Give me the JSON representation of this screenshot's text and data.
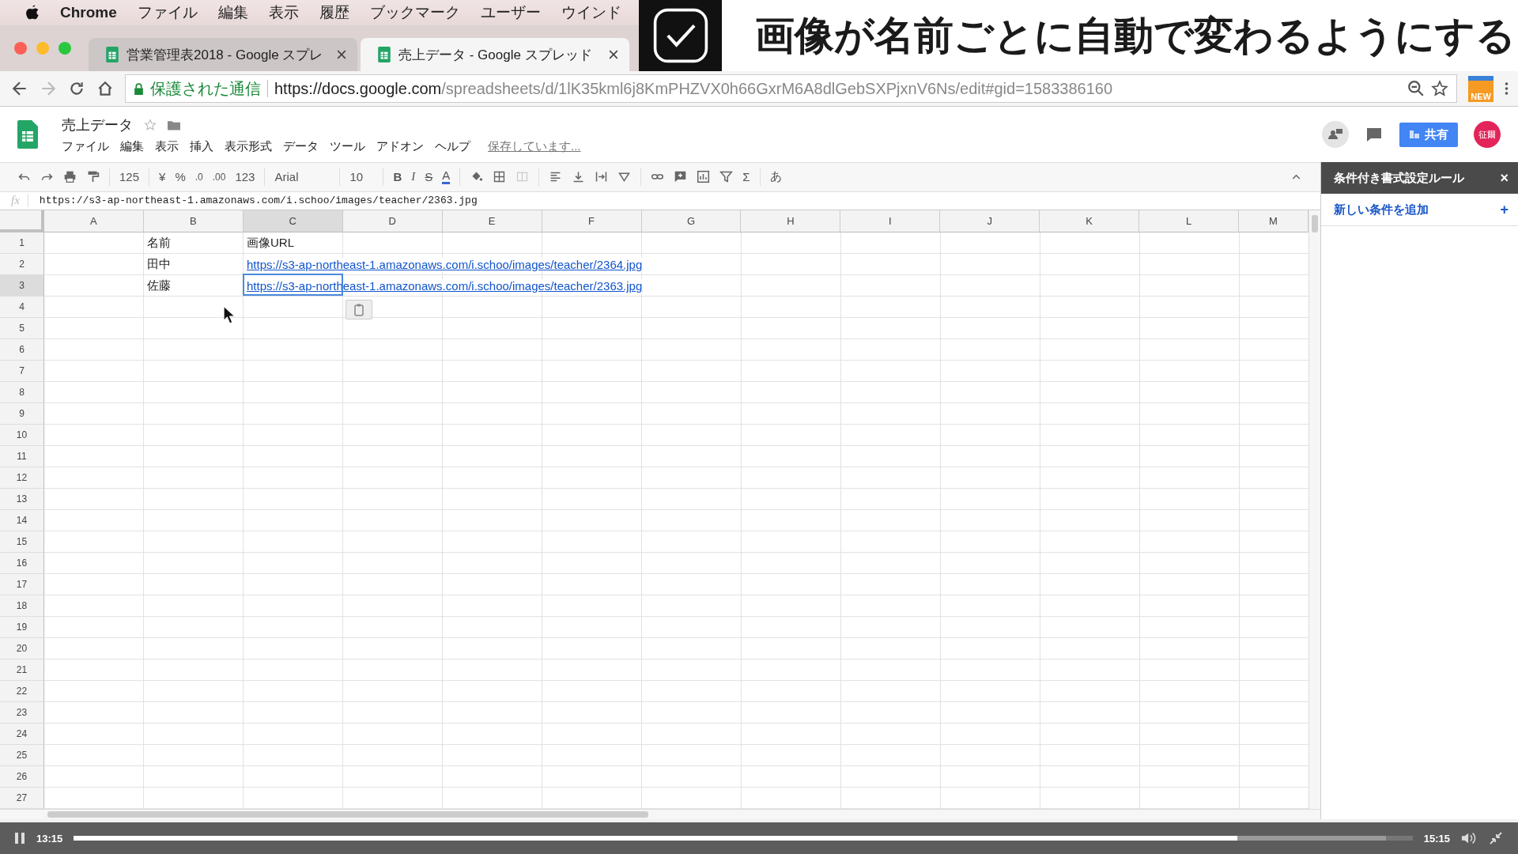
{
  "menu_bar": {
    "app": "Chrome",
    "items": [
      "ファイル",
      "編集",
      "表示",
      "履歴",
      "ブックマーク",
      "ユーザー",
      "ウインド"
    ]
  },
  "browser_tabs": [
    {
      "title": "営業管理表2018 - Google スプレ",
      "selected": false
    },
    {
      "title": "売上データ - Google スプレッド",
      "selected": true
    }
  ],
  "overlay_title": "画像が名前ごとに自動で変わるようにする",
  "address_bar": {
    "security": "保護された通信",
    "url_host": "https://docs.google.com",
    "url_path": "/spreadsheets/d/1lK35kml6j8KmPHZVX0h66GxrM6A8dlGebSXPjxnV6Ns/edit#gid=1583386160",
    "badge": "NEW"
  },
  "doc": {
    "title": "売上データ",
    "menus": [
      "ファイル",
      "編集",
      "表示",
      "挿入",
      "表示形式",
      "データ",
      "ツール",
      "アドオン",
      "ヘルプ"
    ],
    "save_status": "保存しています...",
    "share": "共有",
    "avatar": "征爾"
  },
  "toolbar": {
    "zoom": "125",
    "currency": "¥",
    "percent": "%",
    "decrease_decimal": ".0",
    "increase_decimal": ".00",
    "number_format": "123",
    "font": "Arial",
    "font_size": "10",
    "bold": "B",
    "italic": "I",
    "strike": "S",
    "text_color": "A",
    "sum": "Σ",
    "input_tools": "あ"
  },
  "formula_bar": {
    "label": "fx",
    "value": "https://s3-ap-northeast-1.amazonaws.com/i.schoo/images/teacher/2363.jpg"
  },
  "columns": [
    {
      "label": "A",
      "selected": false
    },
    {
      "label": "B",
      "selected": false
    },
    {
      "label": "C",
      "selected": true
    },
    {
      "label": "D",
      "selected": false
    },
    {
      "label": "E",
      "selected": false
    },
    {
      "label": "F",
      "selected": false
    },
    {
      "label": "G",
      "selected": false
    },
    {
      "label": "H",
      "selected": false
    },
    {
      "label": "I",
      "selected": false
    },
    {
      "label": "J",
      "selected": false
    },
    {
      "label": "K",
      "selected": false
    },
    {
      "label": "L",
      "selected": false
    },
    {
      "label": "M",
      "selected": false
    }
  ],
  "rows": [
    {
      "label": "1",
      "selected": false,
      "cells": [
        null,
        {
          "text": "名前",
          "kind": "text"
        },
        {
          "text": "画像URL",
          "kind": "text"
        }
      ]
    },
    {
      "label": "2",
      "selected": false,
      "cells": [
        null,
        {
          "text": "田中",
          "kind": "text"
        },
        {
          "text": "https://s3-ap-northeast-1.amazonaws.com/i.schoo/images/teacher/2364.jpg",
          "kind": "link",
          "selected": false
        }
      ]
    },
    {
      "label": "3",
      "selected": true,
      "cells": [
        null,
        {
          "text": "佐藤",
          "kind": "text"
        },
        {
          "text": "https://s3-ap-northeast-1.amazonaws.com/i.schoo/images/teacher/2363.jpg",
          "kind": "link",
          "selected": true
        }
      ]
    },
    {
      "label": "4",
      "selected": false,
      "cells": []
    },
    {
      "label": "5",
      "selected": false,
      "cells": []
    },
    {
      "label": "6",
      "selected": false,
      "cells": []
    },
    {
      "label": "7",
      "selected": false,
      "cells": []
    },
    {
      "label": "8",
      "selected": false,
      "cells": []
    },
    {
      "label": "9",
      "selected": false,
      "cells": []
    },
    {
      "label": "10",
      "selected": false,
      "cells": []
    },
    {
      "label": "11",
      "selected": false,
      "cells": []
    },
    {
      "label": "12",
      "selected": false,
      "cells": []
    },
    {
      "label": "13",
      "selected": false,
      "cells": []
    },
    {
      "label": "14",
      "selected": false,
      "cells": []
    },
    {
      "label": "15",
      "selected": false,
      "cells": []
    },
    {
      "label": "16",
      "selected": false,
      "cells": []
    },
    {
      "label": "17",
      "selected": false,
      "cells": []
    },
    {
      "label": "18",
      "selected": false,
      "cells": []
    },
    {
      "label": "19",
      "selected": false,
      "cells": []
    },
    {
      "label": "20",
      "selected": false,
      "cells": []
    },
    {
      "label": "21",
      "selected": false,
      "cells": []
    },
    {
      "label": "22",
      "selected": false,
      "cells": []
    },
    {
      "label": "23",
      "selected": false,
      "cells": []
    },
    {
      "label": "24",
      "selected": false,
      "cells": []
    },
    {
      "label": "25",
      "selected": false,
      "cells": []
    },
    {
      "label": "26",
      "selected": false,
      "cells": []
    },
    {
      "label": "27",
      "selected": false,
      "cells": []
    }
  ],
  "side_panel": {
    "title": "条件付き書式設定ルール",
    "close": "×",
    "add_rule": "新しい条件を追加",
    "add_icon": "+"
  },
  "video": {
    "elapsed": "13:15",
    "duration": "15:15",
    "level": 0.869
  }
}
